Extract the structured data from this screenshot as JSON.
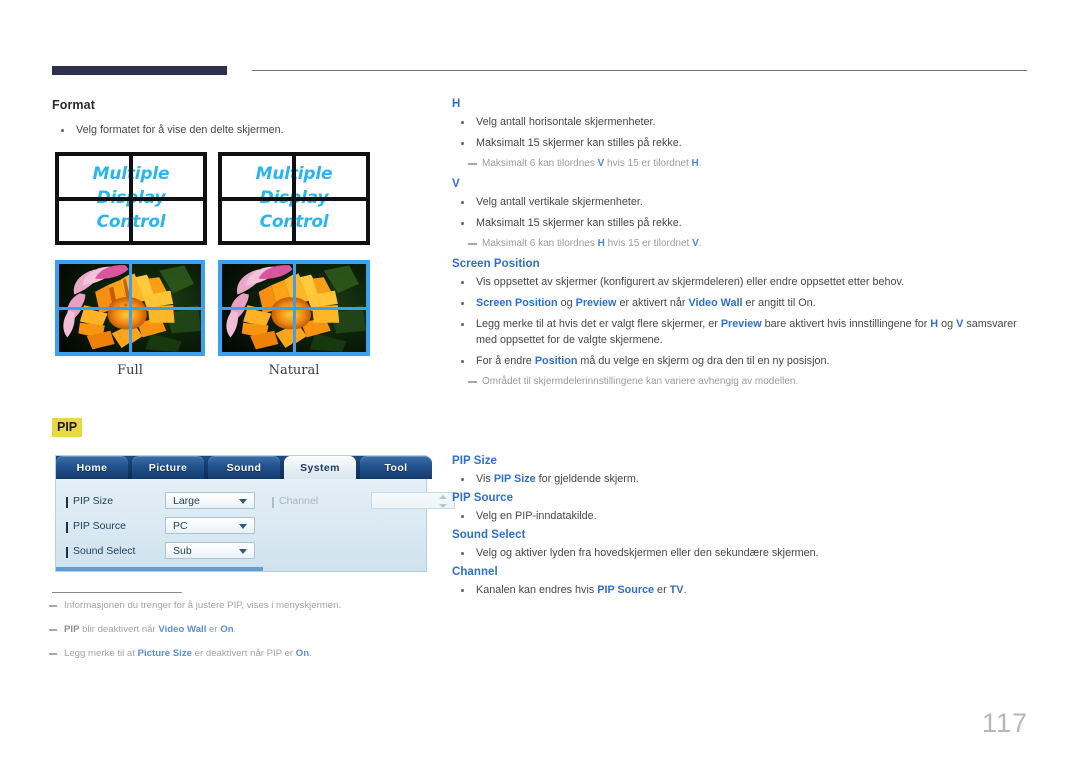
{
  "page_number": "117",
  "left": {
    "format_heading": "Format",
    "format_bullet": "Velg formatet for å vise den delte skjermen.",
    "wall_text_lines": [
      "Multiple",
      "Display",
      "Control"
    ],
    "captions": [
      "Full",
      "Natural"
    ],
    "pip_badge": "PIP",
    "osd": {
      "tabs": [
        {
          "label": "Home",
          "active": false
        },
        {
          "label": "Picture",
          "active": false
        },
        {
          "label": "Sound",
          "active": false
        },
        {
          "label": "System",
          "active": true
        },
        {
          "label": "Tool",
          "active": false
        }
      ],
      "rows": [
        {
          "label": "PIP Size",
          "value": "Large"
        },
        {
          "label": "PIP Source",
          "value": "PC"
        },
        {
          "label": "Sound Select",
          "value": "Sub"
        }
      ],
      "channel_label": "Channel",
      "channel_value": ""
    },
    "footnotes": [
      {
        "parts": [
          {
            "t": "Informasjonen du trenger for å justere PIP, vises i menyskjermen.",
            "s": "n"
          }
        ]
      },
      {
        "parts": [
          {
            "t": "PIP",
            "s": "b"
          },
          {
            "t": " blir deaktivert når ",
            "s": "n"
          },
          {
            "t": "Video Wall",
            "s": "bl"
          },
          {
            "t": " er ",
            "s": "n"
          },
          {
            "t": "On",
            "s": "bl"
          },
          {
            "t": ".",
            "s": "n"
          }
        ]
      },
      {
        "parts": [
          {
            "t": "Legg merke til at ",
            "s": "n"
          },
          {
            "t": "Picture Size",
            "s": "bl"
          },
          {
            "t": " er deaktivert når PIP er ",
            "s": "n"
          },
          {
            "t": "On",
            "s": "bl"
          },
          {
            "t": ".",
            "s": "n"
          }
        ]
      }
    ]
  },
  "right": {
    "sections": [
      {
        "heading": "H",
        "items": [
          {
            "type": "bullet",
            "parts": [
              {
                "t": "Velg antall horisontale skjermenheter.",
                "s": "n"
              }
            ]
          },
          {
            "type": "bullet",
            "parts": [
              {
                "t": "Maksimalt 15 skjermer kan stilles på rekke.",
                "s": "n"
              }
            ]
          },
          {
            "type": "note",
            "parts": [
              {
                "t": "Maksimalt 6 kan tilordnes ",
                "s": "n"
              },
              {
                "t": "V",
                "s": "bl"
              },
              {
                "t": " hvis 15 er tilordnet ",
                "s": "n"
              },
              {
                "t": "H",
                "s": "bl"
              },
              {
                "t": ".",
                "s": "n"
              }
            ]
          }
        ]
      },
      {
        "heading": "V",
        "items": [
          {
            "type": "bullet",
            "parts": [
              {
                "t": "Velg antall vertikale skjermenheter.",
                "s": "n"
              }
            ]
          },
          {
            "type": "bullet",
            "parts": [
              {
                "t": "Maksimalt 15 skjermer kan stilles på rekke.",
                "s": "n"
              }
            ]
          },
          {
            "type": "note",
            "parts": [
              {
                "t": "Maksimalt 6 kan tilordnes ",
                "s": "n"
              },
              {
                "t": "H",
                "s": "bl"
              },
              {
                "t": " hvis 15 er tilordnet ",
                "s": "n"
              },
              {
                "t": "V",
                "s": "bl"
              },
              {
                "t": ".",
                "s": "n"
              }
            ]
          }
        ]
      },
      {
        "heading": "Screen Position",
        "items": [
          {
            "type": "bullet",
            "parts": [
              {
                "t": "Vis oppsettet av skjermer (konfigurert av skjermdeleren) eller endre oppsettet etter behov.",
                "s": "n"
              }
            ]
          },
          {
            "type": "bullet",
            "parts": [
              {
                "t": "Screen Position",
                "s": "bl"
              },
              {
                "t": " og ",
                "s": "n"
              },
              {
                "t": "Preview",
                "s": "bl"
              },
              {
                "t": " er aktivert når ",
                "s": "n"
              },
              {
                "t": "Video Wall",
                "s": "bl"
              },
              {
                "t": " er angitt til On.",
                "s": "n"
              }
            ]
          },
          {
            "type": "bullet",
            "parts": [
              {
                "t": "Legg merke til at hvis det er valgt flere skjermer, er ",
                "s": "n"
              },
              {
                "t": "Preview",
                "s": "bl"
              },
              {
                "t": " bare aktivert hvis innstillingene for ",
                "s": "n"
              },
              {
                "t": "H",
                "s": "bl"
              },
              {
                "t": " og ",
                "s": "n"
              },
              {
                "t": "V",
                "s": "bl"
              },
              {
                "t": " samsvarer med oppsettet for de valgte skjermene.",
                "s": "n"
              }
            ]
          },
          {
            "type": "bullet",
            "parts": [
              {
                "t": "For å endre ",
                "s": "n"
              },
              {
                "t": "Position",
                "s": "bl"
              },
              {
                "t": " må du velge en skjerm og dra den til en ny posisjon.",
                "s": "n"
              }
            ]
          },
          {
            "type": "note",
            "parts": [
              {
                "t": "Området til skjermdelerinnstillingene kan variere avhengig av modellen.",
                "s": "n"
              }
            ]
          }
        ]
      }
    ],
    "sections_lower": [
      {
        "heading": "PIP Size",
        "items": [
          {
            "type": "bullet",
            "parts": [
              {
                "t": "Vis ",
                "s": "n"
              },
              {
                "t": "PIP Size",
                "s": "bl"
              },
              {
                "t": " for gjeldende skjerm.",
                "s": "n"
              }
            ]
          }
        ]
      },
      {
        "heading": "PIP Source",
        "items": [
          {
            "type": "bullet",
            "parts": [
              {
                "t": "Velg en PIP-inndatakilde.",
                "s": "n"
              }
            ]
          }
        ]
      },
      {
        "heading": "Sound Select",
        "items": [
          {
            "type": "bullet",
            "parts": [
              {
                "t": "Velg og aktiver lyden fra hovedskjermen eller den sekundære skjermen.",
                "s": "n"
              }
            ]
          }
        ]
      },
      {
        "heading": "Channel",
        "items": [
          {
            "type": "bullet",
            "parts": [
              {
                "t": "Kanalen kan endres hvis ",
                "s": "n"
              },
              {
                "t": "PIP Source",
                "s": "bl"
              },
              {
                "t": " er ",
                "s": "n"
              },
              {
                "t": "TV",
                "s": "bl"
              },
              {
                "t": ".",
                "s": "n"
              }
            ]
          }
        ]
      }
    ]
  },
  "colors": {
    "accent_blue": "#2f6fd0",
    "wall_text": "#29b6f0",
    "photo_border": "#3aa0f0",
    "header_block": "#2e3050",
    "highlight_yellow": "#e8d943"
  }
}
